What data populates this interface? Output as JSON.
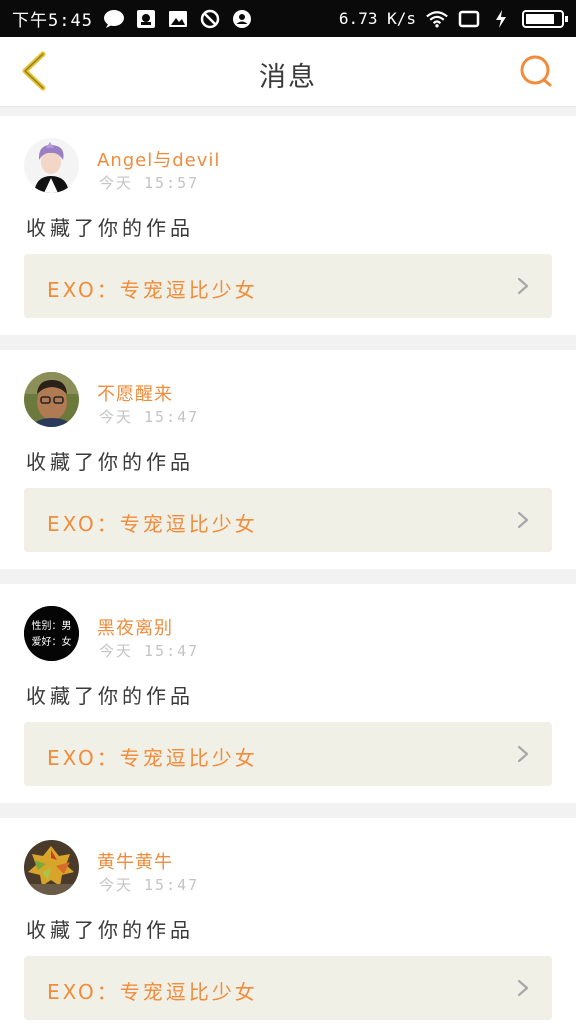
{
  "status_bar": {
    "time": "下午5:45",
    "speed": "6.73",
    "speed_unit": "K/s",
    "battery_level": 0.82,
    "icons": [
      "chat-bubble-icon",
      "notification-icon",
      "image-icon",
      "block-icon",
      "account-icon",
      "wifi-icon",
      "screen-icon",
      "charging-icon",
      "battery-icon"
    ]
  },
  "header": {
    "back_icon": "chevron-left-icon",
    "title": "消息",
    "search_icon": "search-icon"
  },
  "colors": {
    "accent": "#f08c3c",
    "back_icon": "#e6c32a",
    "card_bg": "#ffffff",
    "work_bg": "#f1f0e6",
    "page_bg": "#f2f2f2"
  },
  "messages": [
    {
      "username": "Angel与devil",
      "time": "今天 15:57",
      "action": "收藏了你的作品",
      "work": "EXO：专宠逗比少女"
    },
    {
      "username": "不愿醒来",
      "time": "今天 15:47",
      "action": "收藏了你的作品",
      "work": "EXO：专宠逗比少女"
    },
    {
      "username": "黑夜离别",
      "time": "今天 15:47",
      "action": "收藏了你的作品",
      "work": "EXO：专宠逗比少女",
      "avatar_text": [
        "性别：男",
        "爱好：女"
      ]
    },
    {
      "username": "黄牛黄牛",
      "time": "今天 15:47",
      "action": "收藏了你的作品",
      "work": "EXO：专宠逗比少女"
    }
  ]
}
